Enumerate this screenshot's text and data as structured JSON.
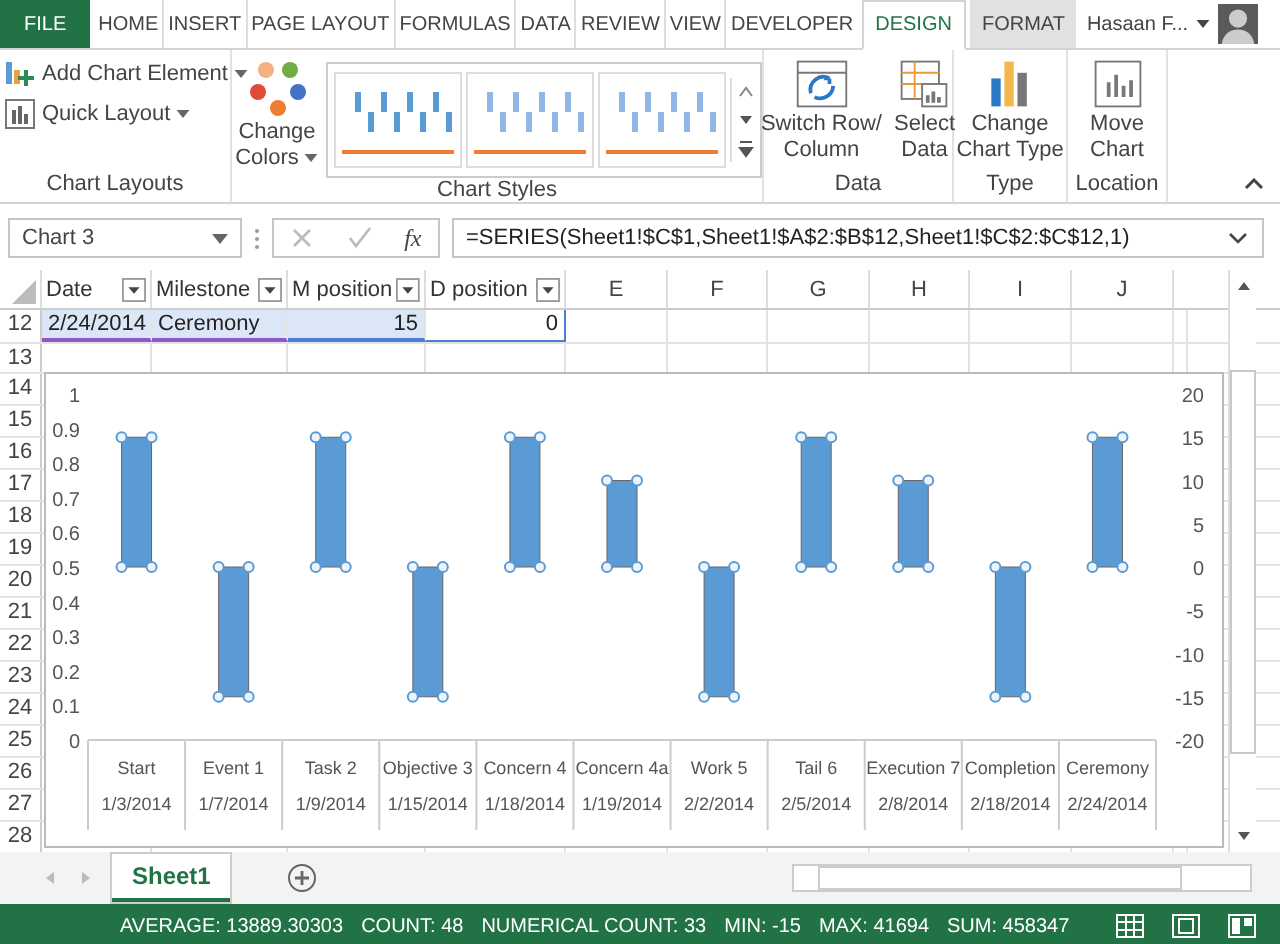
{
  "ribbon": {
    "tabs": [
      {
        "label": "FILE",
        "kind": "file",
        "selected": false
      },
      {
        "label": "HOME",
        "kind": "plain",
        "selected": false
      },
      {
        "label": "INSERT",
        "kind": "plain",
        "selected": false
      },
      {
        "label": "PAGE LAYOUT",
        "kind": "plain",
        "selected": false
      },
      {
        "label": "FORMULAS",
        "kind": "plain",
        "selected": false
      },
      {
        "label": "DATA",
        "kind": "plain",
        "selected": false
      },
      {
        "label": "REVIEW",
        "kind": "plain",
        "selected": false
      },
      {
        "label": "VIEW",
        "kind": "plain",
        "selected": false
      },
      {
        "label": "DEVELOPER",
        "kind": "plain",
        "selected": false
      },
      {
        "label": "DESIGN",
        "kind": "contextual",
        "selected": true
      },
      {
        "label": "FORMAT",
        "kind": "contextual",
        "selected": false
      }
    ],
    "user": "Hasaan F...",
    "groups": [
      {
        "kind": "list",
        "label": "Chart Layouts",
        "items": [
          {
            "label": "Add Chart Element",
            "kind": "add"
          },
          {
            "label": "Quick Layout",
            "kind": "layout"
          }
        ]
      },
      {
        "kind": "styles",
        "label": "Chart Styles",
        "button": {
          "lines": [
            "Change",
            "Colors"
          ]
        }
      },
      {
        "kind": "big",
        "label": "Data",
        "buttons": [
          {
            "lines": [
              "Switch Row/",
              "Column"
            ],
            "kind": "switch"
          },
          {
            "lines": [
              "Select",
              "Data"
            ],
            "kind": "select"
          }
        ]
      },
      {
        "kind": "big",
        "label": "Type",
        "buttons": [
          {
            "lines": [
              "Change",
              "Chart Type"
            ],
            "kind": "type"
          }
        ]
      },
      {
        "kind": "big",
        "label": "Location",
        "buttons": [
          {
            "lines": [
              "Move",
              "Chart"
            ],
            "kind": "move"
          }
        ]
      }
    ]
  },
  "formula_bar": {
    "name_box": "Chart 3",
    "function_label": "fx",
    "formula": "=SERIES(Sheet1!$C$1,Sheet1!$A$2:$B$12,Sheet1!$C$2:$C$12,1)"
  },
  "sheet": {
    "columns": [
      {
        "label": "Date",
        "filter": true
      },
      {
        "label": "Milestone",
        "filter": true
      },
      {
        "label": "M position",
        "filter": true
      },
      {
        "label": "D position",
        "filter": true
      },
      {
        "label": "E",
        "filter": false
      },
      {
        "label": "F",
        "filter": false
      },
      {
        "label": "G",
        "filter": false
      },
      {
        "label": "H",
        "filter": false
      },
      {
        "label": "I",
        "filter": false
      },
      {
        "label": "J",
        "filter": false
      }
    ],
    "rows": [
      {
        "number": "12",
        "cells": [
          {
            "text": "2/24/2014",
            "kind": "category"
          },
          {
            "text": "Ceremony",
            "kind": "category"
          },
          {
            "text": "15",
            "kind": "values"
          },
          {
            "text": "0",
            "kind": "plain-selected"
          }
        ]
      },
      {
        "number": "13"
      },
      {
        "number": "14"
      },
      {
        "number": "15"
      },
      {
        "number": "16"
      },
      {
        "number": "17"
      },
      {
        "number": "18"
      },
      {
        "number": "19"
      },
      {
        "number": "20"
      },
      {
        "number": "21"
      },
      {
        "number": "22"
      },
      {
        "number": "23"
      },
      {
        "number": "24"
      },
      {
        "number": "25"
      },
      {
        "number": "26"
      },
      {
        "number": "27"
      },
      {
        "number": "28"
      }
    ]
  },
  "chart": {
    "left_axis_labels": [
      "1",
      "0.9",
      "0.8",
      "0.7",
      "0.6",
      "0.5",
      "0.4",
      "0.3",
      "0.2",
      "0.1",
      "0"
    ],
    "dates": [
      "1/3/2014",
      "1/7/2014",
      "1/9/2014",
      "1/15/2014",
      "1/18/2014",
      "1/19/2014",
      "2/2/2014",
      "2/5/2014",
      "2/8/2014",
      "2/18/2014",
      "2/24/2014"
    ],
    "chart_data": {
      "type": "bar",
      "categories": [
        "Start",
        "Event 1",
        "Task 2",
        "Objective 3",
        "Concern 4",
        "Concern 4a",
        "Work 5",
        "Tail 6",
        "Execution 7",
        "Completion",
        "Ceremony"
      ],
      "series": [
        {
          "color": "#5b9bd5",
          "values": [
            15,
            -15,
            15,
            -15,
            15,
            10,
            -15,
            15,
            10,
            -15,
            15
          ]
        }
      ],
      "ylim": [
        -20,
        20
      ],
      "yticks": [
        -20,
        -15,
        -10,
        -5,
        0,
        5,
        10,
        15,
        20
      ]
    }
  },
  "sheet_tabs": [
    {
      "label": "Sheet1",
      "selected": true
    }
  ],
  "status_bar": {
    "items": [
      "AVERAGE: 13889.30303",
      "COUNT: 48",
      "NUMERICAL COUNT: 33",
      "MIN: -15",
      "MAX: 41694",
      "SUM: 458347"
    ],
    "views": [
      {
        "kind": "normal"
      },
      {
        "kind": "page-layout"
      },
      {
        "kind": "page-break"
      }
    ]
  }
}
